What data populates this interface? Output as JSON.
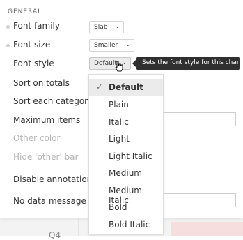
{
  "section": {
    "title": "GENERAL"
  },
  "rows": {
    "font_family": {
      "label": "Font family",
      "value": "Slab"
    },
    "font_size": {
      "label": "Font size",
      "value": "Smaller"
    },
    "font_style": {
      "label": "Font style",
      "value": "Default"
    },
    "sort_on_totals": {
      "label": "Sort on totals"
    },
    "sort_each_category": {
      "label": "Sort each category"
    },
    "maximum_items": {
      "label": "Maximum items"
    },
    "other_color": {
      "label": "Other color"
    },
    "hide_other_bar": {
      "label": "Hide 'other' bar"
    },
    "disable_annotations": {
      "label": "Disable annotations"
    },
    "no_data_message": {
      "label": "No data message"
    }
  },
  "tooltip": {
    "text": "Sets the font style for this chart."
  },
  "menu": {
    "items": [
      "Default",
      "Plain",
      "Italic",
      "Light",
      "Light Italic",
      "Medium",
      "Medium Italic",
      "Bold",
      "Bold Italic"
    ],
    "selected_index": 0,
    "check": "✓"
  },
  "background": {
    "category_label": "Q4"
  },
  "icons": {
    "chevron": "chevron-down-icon",
    "check": "check-icon",
    "cursor": "hand-pointer-icon"
  }
}
